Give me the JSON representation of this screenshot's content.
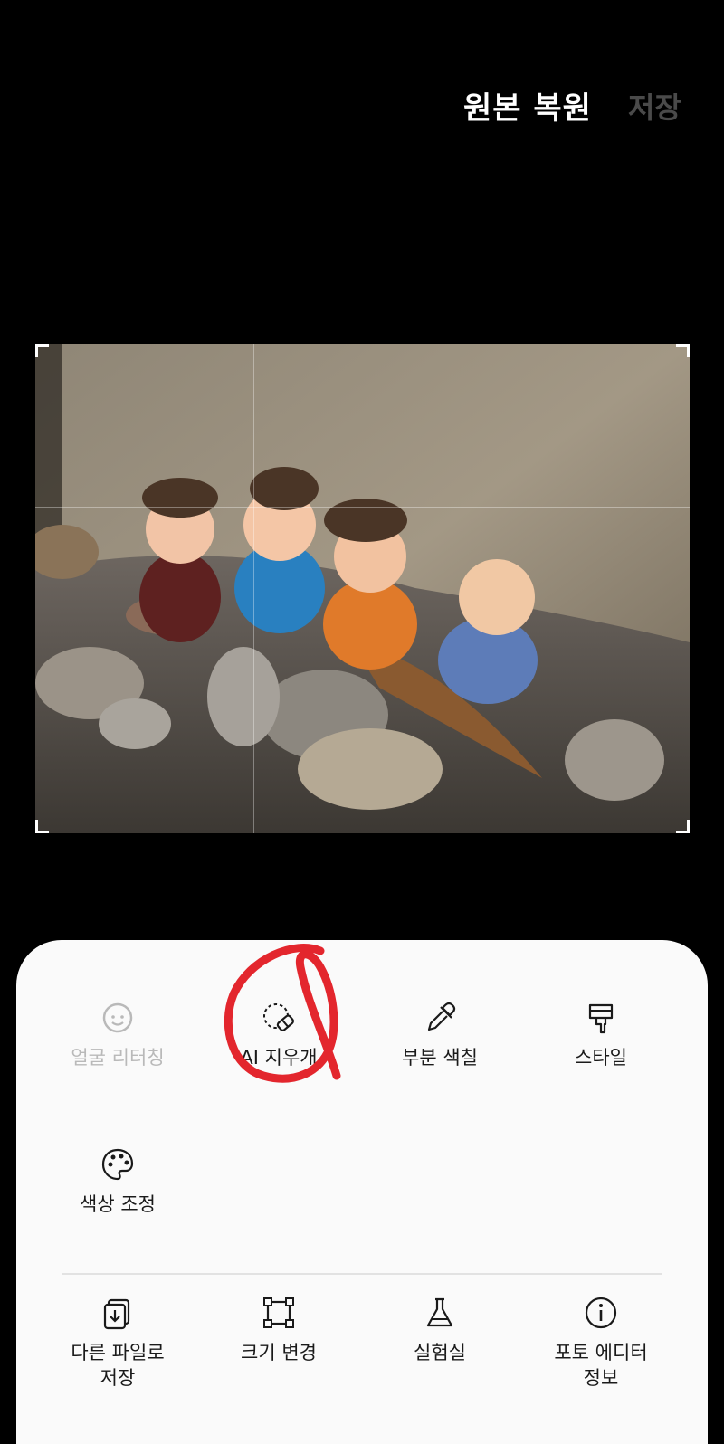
{
  "header": {
    "revert_label": "원본 복원",
    "save_label": "저장"
  },
  "photo": {
    "icon": "photo-of-monk-figurines"
  },
  "tools": {
    "face_retouch": {
      "label": "얼굴 리터칭",
      "icon": "face-icon",
      "enabled": false
    },
    "ai_eraser": {
      "label": "AI 지우개",
      "icon": "eraser-icon"
    },
    "partial_color": {
      "label": "부분 색칠",
      "icon": "eyedropper-icon"
    },
    "style": {
      "label": "스타일",
      "icon": "paintbrush-icon"
    },
    "color_adjust": {
      "label": "색상 조정",
      "icon": "palette-icon"
    }
  },
  "actions": {
    "save_as": {
      "label": "다른 파일로\n저장",
      "icon": "save-copy-icon"
    },
    "resize": {
      "label": "크기 변경",
      "icon": "resize-icon"
    },
    "labs": {
      "label": "실험실",
      "icon": "flask-icon"
    },
    "info": {
      "label": "포토 에디터\n정보",
      "icon": "info-icon"
    }
  },
  "colors": {
    "accent_annotation": "#e3262d",
    "disabled_text": "#b9b9b9"
  }
}
